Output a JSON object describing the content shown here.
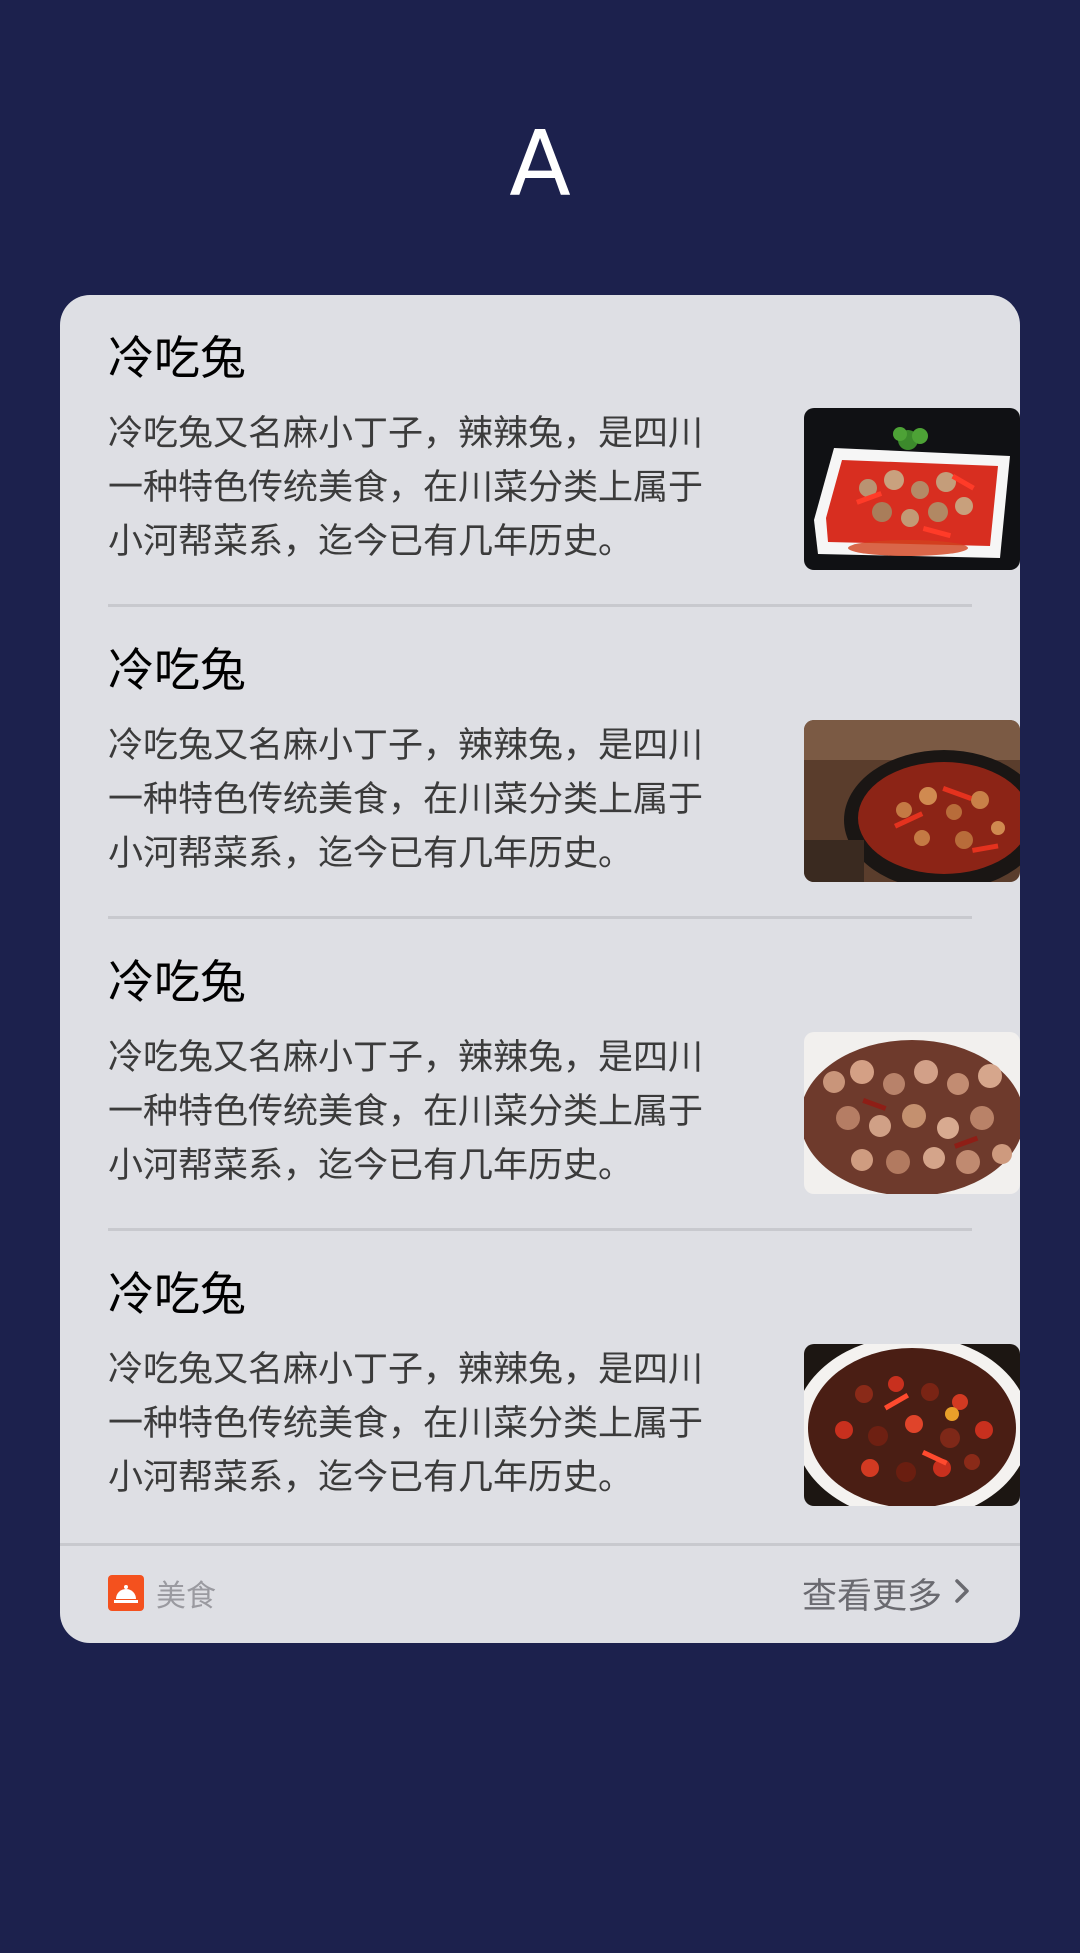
{
  "header": {
    "letter": "A"
  },
  "card": {
    "items": [
      {
        "title": "冷吃兔",
        "description": "冷吃兔又名麻小丁子，辣辣兔，是四川一种特色传统美食，在川菜分类上属于小河帮菜系，迄今已有几年历史。",
        "image_icon": "spicy-rabbit-plate-image"
      },
      {
        "title": "冷吃兔",
        "description": "冷吃兔又名麻小丁子，辣辣兔，是四川一种特色传统美食，在川菜分类上属于小河帮菜系，迄今已有几年历史。",
        "image_icon": "spicy-rabbit-pot-image"
      },
      {
        "title": "冷吃兔",
        "description": "冷吃兔又名麻小丁子，辣辣兔，是四川一种特色传统美食，在川菜分类上属于小河帮菜系，迄今已有几年历史。",
        "image_icon": "spicy-rabbit-bowl-image"
      },
      {
        "title": "冷吃兔",
        "description": "冷吃兔又名麻小丁子，辣辣兔，是四川一种特色传统美食，在川菜分类上属于小河帮菜系，迄今已有几年历史。",
        "image_icon": "spicy-rabbit-dish-image"
      }
    ],
    "footer": {
      "category_label": "美食",
      "category_icon": "food-cloche-icon",
      "more_label": "查看更多",
      "more_icon": "chevron-right-icon"
    }
  },
  "colors": {
    "background": "#1c214d",
    "card": "#dedfe4",
    "category_icon": "#f4511e"
  }
}
